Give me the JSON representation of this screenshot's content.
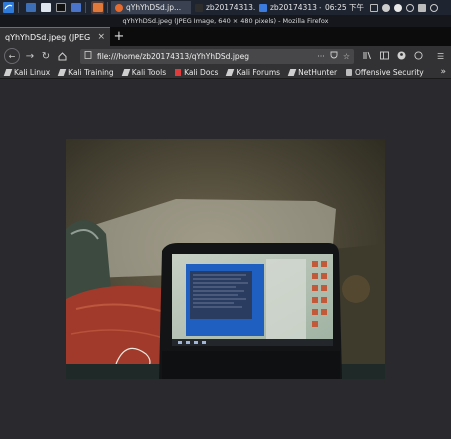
{
  "panel": {
    "tasks": [
      {
        "label": "qYhYhDSd.jp..."
      },
      {
        "label": "zb20174313..."
      },
      {
        "label": "zb20174313 -..."
      }
    ],
    "clock": "06:25 下午"
  },
  "window": {
    "title": "qYhYhDSd.jpeg (JPEG Image, 640 × 480 pixels) - Mozilla Firefox"
  },
  "tab": {
    "label": "qYhYhDSd.jpeg (JPEG Image",
    "close": "×"
  },
  "navbar": {
    "url": "file:///home/zb20174313/qYhYhDSd.jpeg",
    "more": "···"
  },
  "bookmarks": [
    {
      "label": "Kali Linux",
      "icon": "kali-icon",
      "color": "#d9d9d9"
    },
    {
      "label": "Kali Training",
      "icon": "kali-icon",
      "color": "#d9d9d9"
    },
    {
      "label": "Kali Tools",
      "icon": "kali-icon",
      "color": "#d9d9d9"
    },
    {
      "label": "Kali Docs",
      "icon": "docs-icon",
      "color": "#e23b3b"
    },
    {
      "label": "Kali Forums",
      "icon": "kali-icon",
      "color": "#d9d9d9"
    },
    {
      "label": "NetHunter",
      "icon": "kali-icon",
      "color": "#d9d9d9"
    },
    {
      "label": "Offensive Security",
      "icon": "offsec-icon",
      "color": "#c9c9c9"
    }
  ],
  "colors": {
    "accent": "#0a84ff",
    "toolbar": "#323234",
    "content_bg": "#2a2a2e"
  },
  "image": {
    "description_icon": "webcam-photo-of-laptop"
  }
}
